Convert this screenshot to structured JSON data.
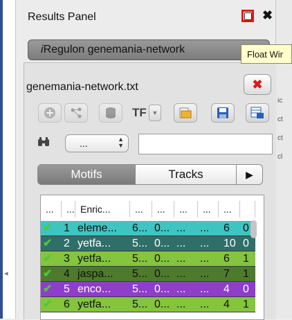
{
  "panel": {
    "title": "Results Panel"
  },
  "tooltip": {
    "text": "Float Wir"
  },
  "network_tab": {
    "prefix": "i",
    "label": "Regulon genemania-network"
  },
  "file": {
    "name": "genemania-network.txt"
  },
  "toolbar": {
    "tf_label": "TF"
  },
  "filter": {
    "select_value": "...",
    "search_value": ""
  },
  "tabs": [
    {
      "label": "Motifs",
      "active": true
    },
    {
      "label": "Tracks",
      "active": false
    }
  ],
  "table": {
    "columns": [
      "...",
      "...",
      "Enric...",
      "...",
      "...",
      "...",
      "...",
      "...",
      ""
    ],
    "rows": [
      {
        "num": "1",
        "name": "eleme...",
        "c4": "6...",
        "c5": "0...",
        "c6": "...",
        "c7": "...",
        "c8": "6",
        "c9": "0",
        "color": "#3fc5c1",
        "text": "#111111"
      },
      {
        "num": "2",
        "name": "yetfa...",
        "c4": "5...",
        "c5": "0...",
        "c6": "...",
        "c7": "...",
        "c8": "10",
        "c9": "0",
        "color": "#2f6f6a",
        "text": "#ffffff"
      },
      {
        "num": "3",
        "name": "yetfa...",
        "c4": "5...",
        "c5": "0...",
        "c6": "...",
        "c7": "...",
        "c8": "6",
        "c9": "1",
        "color": "#84c43e",
        "text": "#111111"
      },
      {
        "num": "4",
        "name": "jaspa...",
        "c4": "5...",
        "c5": "0...",
        "c6": "...",
        "c7": "...",
        "c8": "7",
        "c9": "1",
        "color": "#4e7a2c",
        "text": "#111111"
      },
      {
        "num": "5",
        "name": "enco...",
        "c4": "5...",
        "c5": "0...",
        "c6": "...",
        "c7": "...",
        "c8": "4",
        "c9": "0",
        "color": "#8e3ec9",
        "text": "#ffffff"
      },
      {
        "num": "6",
        "name": "yetfa...",
        "c4": "5...",
        "c5": "0...",
        "c6": "...",
        "c7": "...",
        "c8": "4",
        "c9": "1",
        "color": "#84c43e",
        "text": "#111111"
      }
    ]
  },
  "icons": {
    "float": "float-window-icon",
    "close": "close-icon",
    "remove": "remove-red-x-icon",
    "add": "add-circle-icon",
    "network": "network-nodes-icon",
    "db": "database-icon",
    "tf_dropdown": "chevron-down-icon",
    "open": "open-folder-icon",
    "save": "save-floppy-icon",
    "export": "export-table-icon",
    "binoculars": "binoculars-icon",
    "more": "chevron-right-icon"
  },
  "colors": {
    "highlight": "#e01818",
    "tooltip_bg": "#ffffcc"
  }
}
